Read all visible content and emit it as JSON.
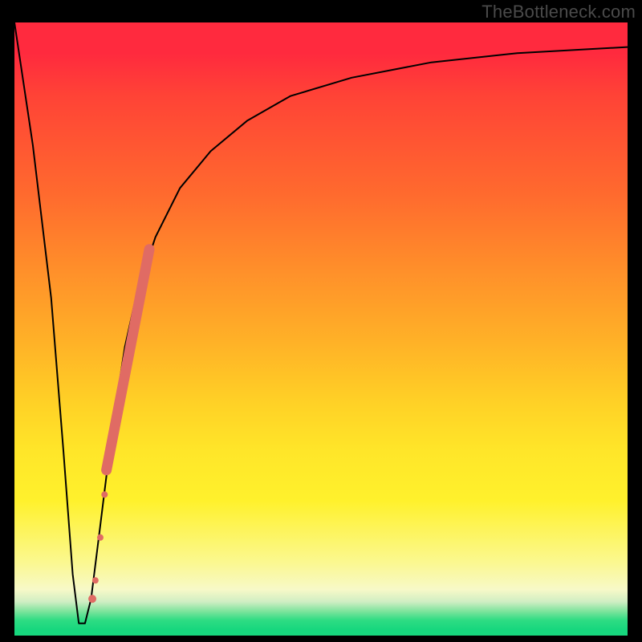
{
  "attribution": "TheBottleneck.com",
  "colors": {
    "marker": "#e06b64",
    "curve": "#000000",
    "frame": "#000000"
  },
  "chart_data": {
    "type": "line",
    "title": "",
    "xlabel": "",
    "ylabel": "",
    "xlim": [
      0,
      100
    ],
    "ylim": [
      0,
      100
    ],
    "grid": false,
    "legend": false,
    "series": [
      {
        "name": "bottleneck-curve",
        "x": [
          0,
          3,
          6,
          8,
          9.5,
          10.5,
          11.5,
          12.5,
          14,
          16,
          18,
          20,
          23,
          27,
          32,
          38,
          45,
          55,
          68,
          82,
          100
        ],
        "y": [
          100,
          80,
          55,
          30,
          10,
          2,
          2,
          6,
          18,
          34,
          47,
          56,
          65,
          73,
          79,
          84,
          88,
          91,
          93.5,
          95,
          96
        ]
      }
    ],
    "markers": {
      "name": "highlight-segment",
      "color": "#e06b64",
      "segment": {
        "x0": 15.0,
        "y0": 27,
        "x1": 22.0,
        "y1": 63
      },
      "points": [
        {
          "x": 14.0,
          "y": 16,
          "r": 4
        },
        {
          "x": 14.7,
          "y": 23,
          "r": 4
        },
        {
          "x": 13.2,
          "y": 9,
          "r": 4
        },
        {
          "x": 12.7,
          "y": 6,
          "r": 5
        }
      ]
    }
  }
}
